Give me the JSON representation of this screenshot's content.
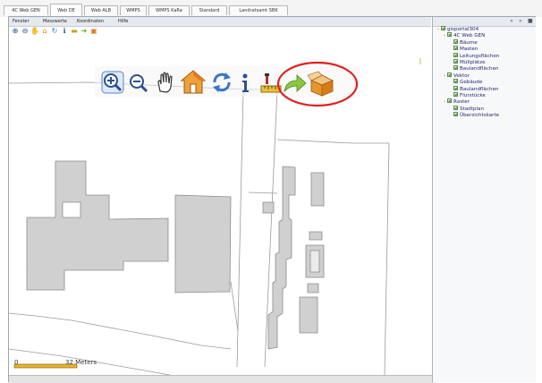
{
  "tabs": [
    {
      "label": "4C Web GEN"
    },
    {
      "label": "Web DE"
    },
    {
      "label": "Web ALB"
    },
    {
      "label": "WMPS"
    },
    {
      "label": "WMPS KaRa"
    },
    {
      "label": "Standard"
    },
    {
      "label": "Landratsamt SBK"
    }
  ],
  "menu": {
    "items": [
      {
        "label": "Fenster"
      },
      {
        "label": "Messwerte"
      },
      {
        "label": "Koordinaten"
      },
      {
        "label": "Hilfe"
      }
    ]
  },
  "toolbar": {
    "tools": [
      {
        "icon": "zoom-in-icon"
      },
      {
        "icon": "zoom-out-icon"
      },
      {
        "icon": "pan-hand-icon"
      },
      {
        "icon": "home-icon"
      },
      {
        "icon": "refresh-icon"
      },
      {
        "icon": "info-icon"
      },
      {
        "icon": "measure-icon"
      },
      {
        "icon": "forward-arrow-icon"
      },
      {
        "icon": "open-box-icon"
      }
    ],
    "highlight_color": "#e02020"
  },
  "scale": {
    "start_label": "0",
    "end_label": "32 Meters"
  },
  "layers_panel": {
    "controls": [
      "«",
      "»",
      "■"
    ],
    "tree": [
      {
        "label": "gisportal304",
        "depth": 0,
        "expander": "-"
      },
      {
        "label": "4C Web GEN",
        "depth": 1,
        "expander": "-"
      },
      {
        "label": "Bäume",
        "depth": 2,
        "expander": ""
      },
      {
        "label": "Masten",
        "depth": 2,
        "expander": ""
      },
      {
        "label": "Leitungsflächen",
        "depth": 2,
        "expander": ""
      },
      {
        "label": "Müllplätze",
        "depth": 2,
        "expander": ""
      },
      {
        "label": "Baulandflächen",
        "depth": 2,
        "expander": ""
      },
      {
        "label": "Vektor",
        "depth": 1,
        "expander": "-"
      },
      {
        "label": "Gebäude",
        "depth": 2,
        "expander": ""
      },
      {
        "label": "Baulandflächen",
        "depth": 2,
        "expander": ""
      },
      {
        "label": "Flurstücke",
        "depth": 2,
        "expander": ""
      },
      {
        "label": "Raster",
        "depth": 1,
        "expander": "-"
      },
      {
        "label": "Stadtplan",
        "depth": 2,
        "expander": ""
      },
      {
        "label": "Übersichtskarte",
        "depth": 2,
        "expander": ""
      }
    ]
  },
  "colors": {
    "building_fill": "#d0d0d0",
    "building_stroke": "#8c8c8c",
    "parcel_line": "#9a9a9a",
    "scale_bar": "#e8b32a",
    "tree_text": "#2a2a6a"
  }
}
